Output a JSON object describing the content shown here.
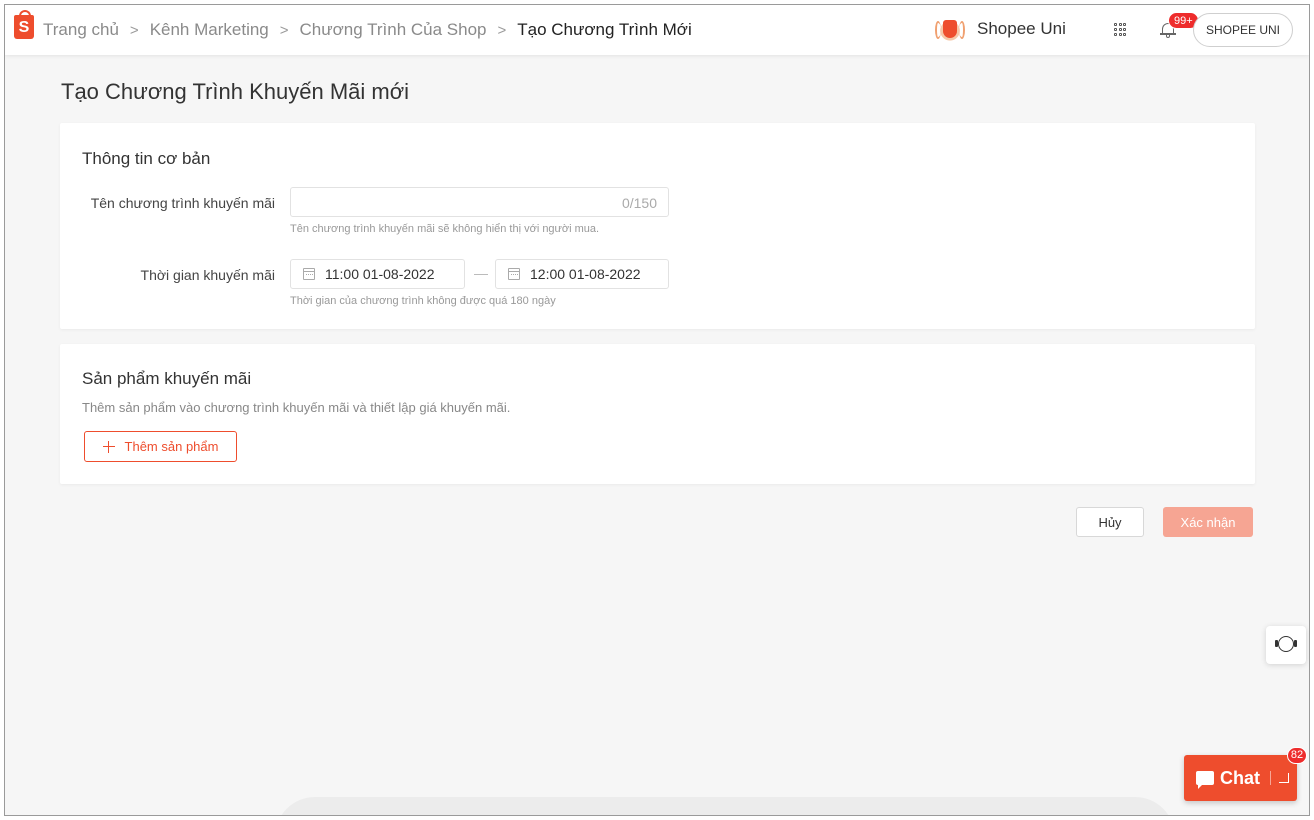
{
  "header": {
    "breadcrumb": [
      {
        "label": "Trang chủ"
      },
      {
        "label": "Kênh Marketing"
      },
      {
        "label": "Chương Trình Của Shop"
      },
      {
        "label": "Tạo Chương Trình Mới"
      }
    ],
    "separator": ">",
    "logo_letter": "S",
    "uni_label": "Shopee Uni",
    "notification_count": "99+",
    "account_label": "SHOPEE UNI",
    "brand_color": "#ee4d2d"
  },
  "page": {
    "title": "Tạo Chương Trình Khuyến Mãi mới"
  },
  "basic_info": {
    "title": "Thông tin cơ bản",
    "name_label": "Tên chương trình khuyến mãi",
    "name_value": "",
    "name_counter": "0/150",
    "name_hint": "Tên chương trình khuyến mãi sẽ không hiển thị với người mua.",
    "time_label": "Thời gian khuyến mãi",
    "start_time": "11:00 01-08-2022",
    "end_time": "12:00 01-08-2022",
    "time_hint": "Thời gian của chương trình không được quá 180 ngày"
  },
  "products": {
    "title": "Sản phẩm khuyến mãi",
    "description": "Thêm sản phẩm vào chương trình khuyến mãi và thiết lập giá khuyến mãi.",
    "add_button": "Thêm sản phẩm"
  },
  "actions": {
    "cancel": "Hủy",
    "confirm": "Xác nhận"
  },
  "chat": {
    "label": "Chat",
    "badge": "82"
  },
  "icons": [
    "shopee-logo-icon",
    "chevron-right-icon",
    "shopee-uni-icon",
    "apps-grid-icon",
    "bell-icon",
    "calendar-icon",
    "plus-icon",
    "headset-support-icon",
    "chat-icon",
    "minimize-icon"
  ]
}
